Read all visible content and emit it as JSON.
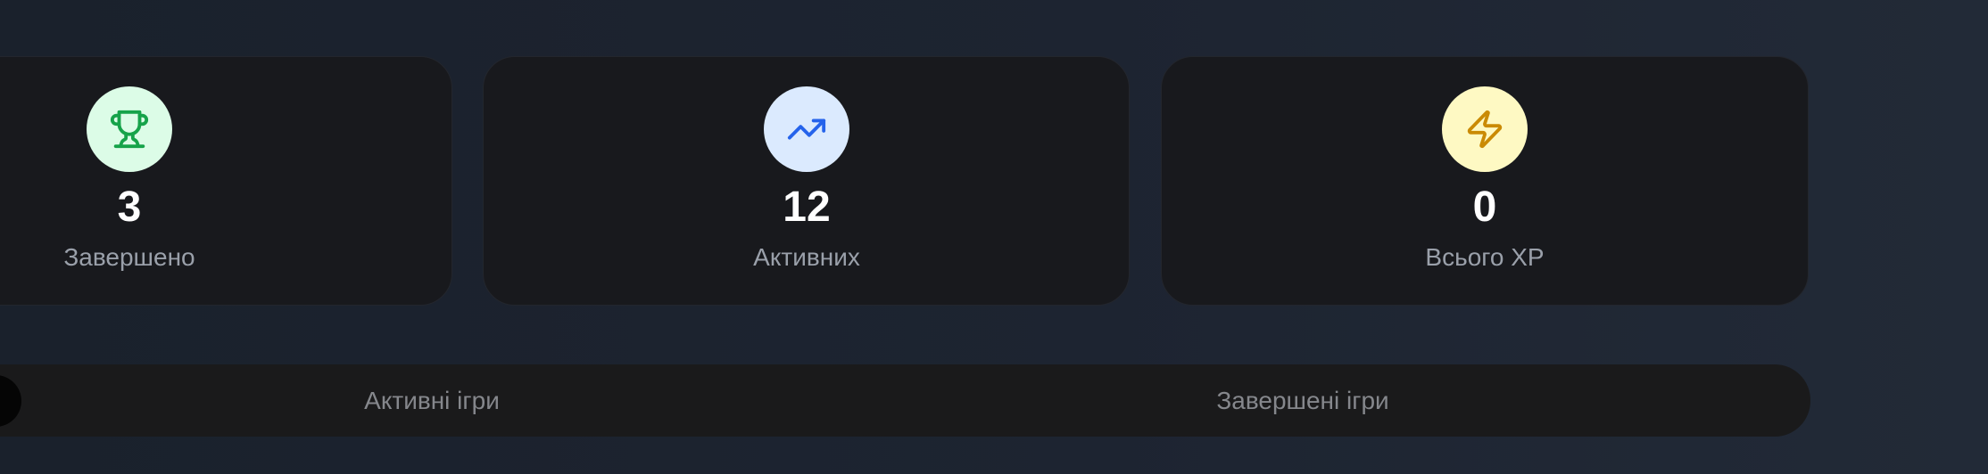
{
  "stats": [
    {
      "value": "3",
      "label": "Завершено",
      "icon": "trophy-icon",
      "icon_bg": "#dcfce7",
      "icon_color": "#16a34a"
    },
    {
      "value": "12",
      "label": "Активних",
      "icon": "trending-up-icon",
      "icon_bg": "#dbeafe",
      "icon_color": "#2563eb"
    },
    {
      "value": "0",
      "label": "Всього XP",
      "icon": "lightning-bolt-icon",
      "icon_bg": "#fef9c3",
      "icon_color": "#ca8a04"
    }
  ],
  "tabs": {
    "active_games": "Активні ігри",
    "completed_games": "Завершені ігри"
  },
  "colors": {
    "background": "#1d2431",
    "card_bg": "#18191d",
    "tabs_bg": "#1a1a1b",
    "value_text": "#ffffff",
    "label_text": "#9aa0aa",
    "tab_text": "#85878c"
  }
}
